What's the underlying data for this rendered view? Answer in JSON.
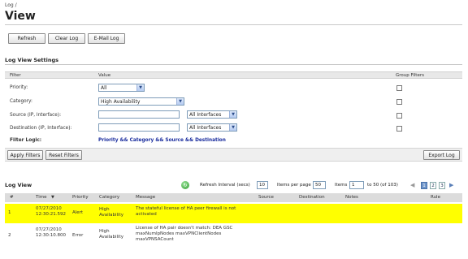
{
  "breadcrumb": "Log /",
  "title": "View",
  "toolbar": {
    "refresh": "Refresh",
    "clear_log": "Clear Log",
    "email_log": "E-Mail Log"
  },
  "settings": {
    "title": "Log View Settings",
    "headers": {
      "filter": "Filter",
      "value": "Value",
      "group": "Group Filters"
    },
    "priority_label": "Priority:",
    "priority_value": "All",
    "category_label": "Category:",
    "category_value": "High Availability",
    "source_label": "Source (IP, Interface):",
    "source_iface": "All Interfaces",
    "dest_label": "Destination (IP, Interface):",
    "dest_iface": "All Interfaces",
    "logic_label": "Filter Logic:",
    "logic_value": "Priority && Category && Source && Destination",
    "apply": "Apply Filters",
    "reset": "Reset Filters",
    "export": "Export Log"
  },
  "logview": {
    "title": "Log View",
    "refresh_label": "Refresh Interval (secs)",
    "refresh_value": "10",
    "perpage_label": "Items per page",
    "perpage_value": "50",
    "items_label": "Items",
    "items_value": "1",
    "items_range": "to 50 (of 103)",
    "pages": [
      "1",
      "2",
      "3"
    ],
    "columns": {
      "num": "#",
      "time": "Time",
      "priority": "Priority",
      "category": "Category",
      "message": "Message",
      "source": "Source",
      "destination": "Destination",
      "notes": "Notes",
      "rule": "Rule"
    },
    "rows": [
      {
        "num": "1",
        "date": "07/27/2010",
        "time": "12:30:21.592",
        "priority": "Alert",
        "cat1": "High",
        "cat2": "Availability",
        "msg1": "The stateful license of HA peer firewall is not",
        "msg2": "activated",
        "msg3": ""
      },
      {
        "num": "2",
        "date": "07/27/2010",
        "time": "12:30:10.800",
        "priority": "Error",
        "cat1": "High",
        "cat2": "Availability",
        "msg1": "License of HA pair doesn't match: DEA GSC",
        "msg2": "maxNumIpNodes maxVPNClientNodes",
        "msg3": "maxVPNSACount"
      }
    ]
  },
  "colors": {
    "highlight": "#ffff00",
    "logic": "#1a2d9e"
  }
}
